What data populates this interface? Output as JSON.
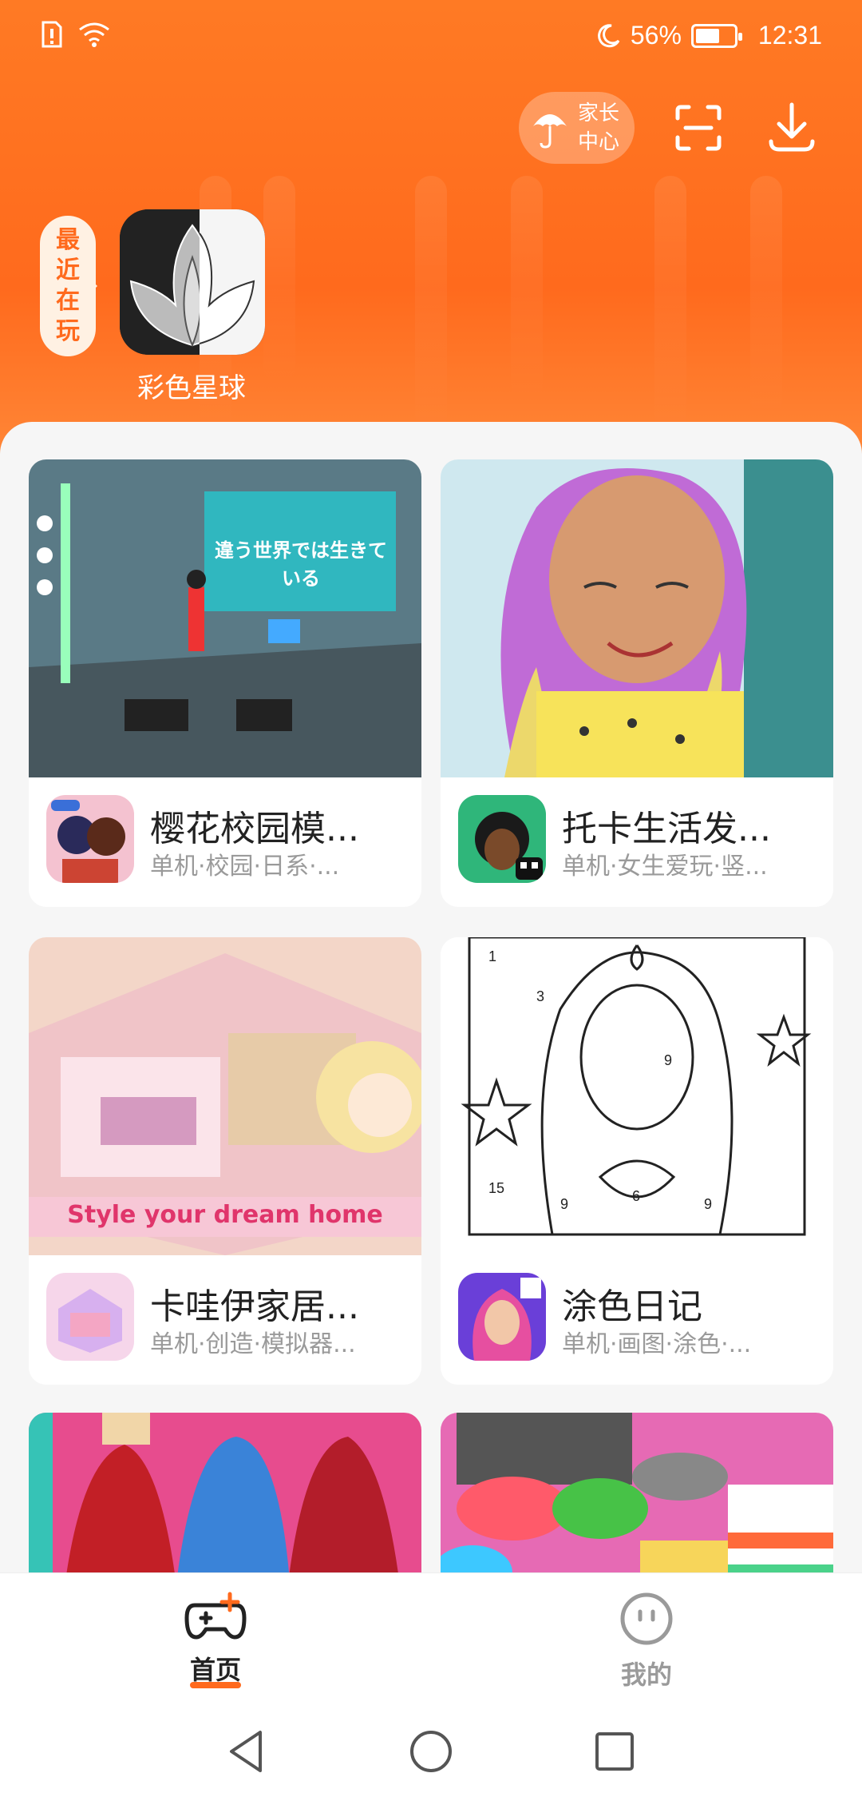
{
  "status": {
    "time": "12:31",
    "battery": "56%",
    "icons": [
      "alert-icon",
      "wifi-icon",
      "moon-icon"
    ]
  },
  "header": {
    "parent_center_label": "家长中心",
    "parent_center_line1": "家长",
    "parent_center_line2": "中心",
    "scan_icon": "scan-icon",
    "download_icon": "download-icon"
  },
  "recent": {
    "tag_chars": [
      "最",
      "近",
      "在",
      "玩"
    ],
    "app_name": "彩色星球"
  },
  "games": [
    {
      "title": "樱花校园模...",
      "tags": "单机·校园·日系·..."
    },
    {
      "title": "托卡生活发...",
      "tags": "单机·女生爱玩·竖..."
    },
    {
      "title": "卡哇伊家居...",
      "tags": "单机·创造·模拟器..."
    },
    {
      "title": "涂色日记",
      "tags": "单机·画图·涂色·..."
    }
  ],
  "screenshot_text": {
    "sakura_banner": "違う世界では生きている",
    "kawaii_banner": "Style your dream home"
  },
  "tabs": {
    "home": "首页",
    "mine": "我的"
  },
  "colors": {
    "accent": "#ff6a1d",
    "header_bg": "#ff7a24"
  }
}
